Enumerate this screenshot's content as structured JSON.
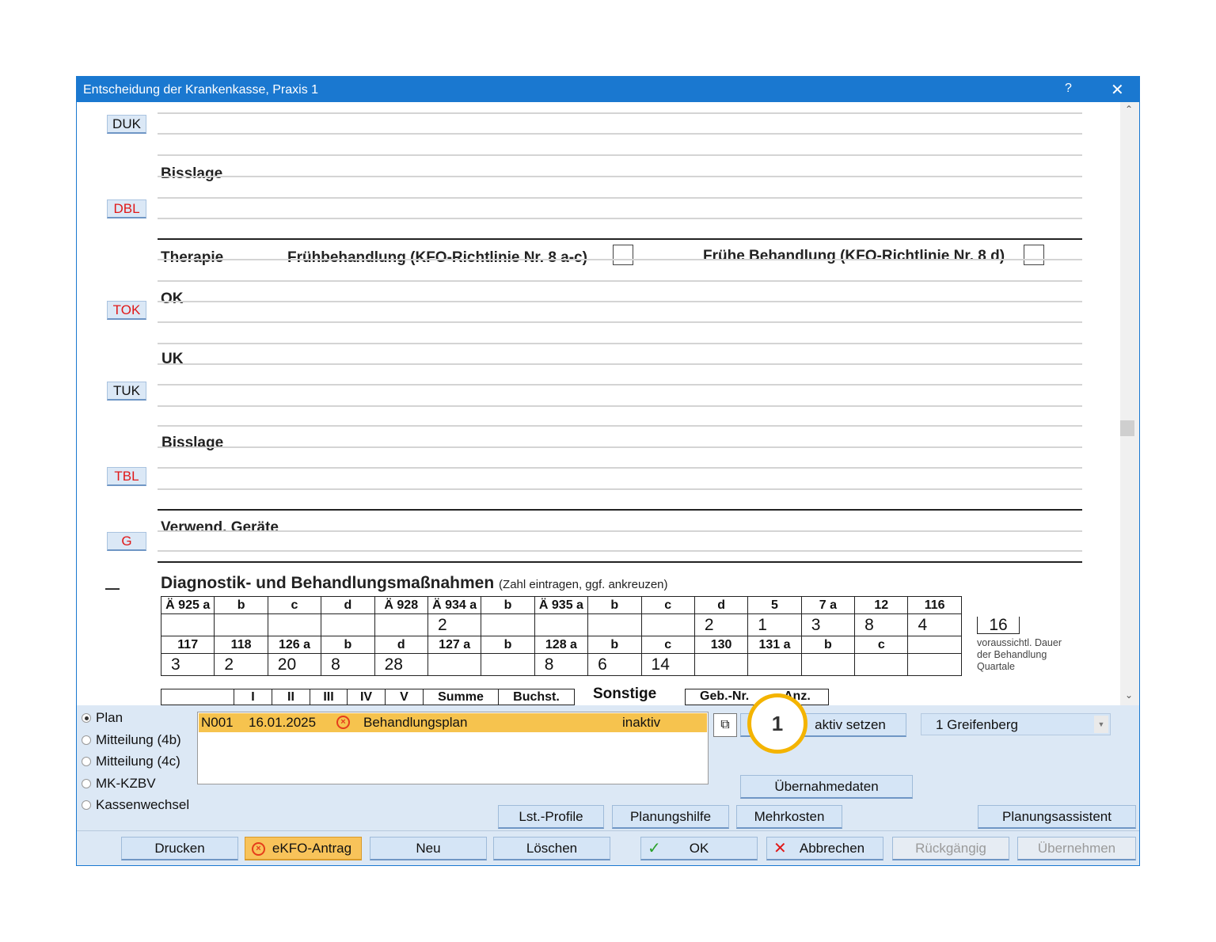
{
  "window": {
    "title": "Entscheidung der Krankenkasse, Praxis 1",
    "help": "?",
    "close": "✕"
  },
  "scroll": {
    "up": "⌃",
    "down": "⌄"
  },
  "tags": {
    "duk": "DUK",
    "dbl": "DBL",
    "tok": "TOK",
    "tuk": "TUK",
    "tbl": "TBL",
    "g": "G",
    "dash": "—"
  },
  "labels": {
    "bisslage1": "Bisslage",
    "therapie": "Therapie",
    "fruehbehandlung": "Frühbehandlung (KFO-Richtlinie Nr. 8 a-c)",
    "fruehe_behandlung": "Frühe Behandlung (KFO-Richtlinie Nr. 8 d)",
    "ok": "OK",
    "uk": "UK",
    "bisslage2": "Bisslage",
    "geraete": "Verwend. Geräte",
    "diag_title": "Diagnostik- und Behandlungsmaßnahmen",
    "diag_hint": "(Zahl eintragen, ggf. ankreuzen)"
  },
  "grid": {
    "row1_headers": [
      "Ä 925 a",
      "b",
      "c",
      "d",
      "Ä 928",
      "Ä 934 a",
      "b",
      "Ä 935 a",
      "b",
      "c",
      "d",
      "5",
      "7 a",
      "12",
      "116"
    ],
    "row1_values": [
      "",
      "",
      "",
      "",
      "",
      "2",
      "",
      "",
      "",
      "",
      "2",
      "1",
      "3",
      "8",
      "4"
    ],
    "row2_headers": [
      "117",
      "118",
      "126 a",
      "b",
      "d",
      "127 a",
      "b",
      "128 a",
      "b",
      "c",
      "130",
      "131 a",
      "b",
      "c",
      ""
    ],
    "row2_values": [
      "3",
      "2",
      "20",
      "8",
      "28",
      "",
      "",
      "8",
      "6",
      "14",
      "",
      "",
      "",
      "",
      ""
    ]
  },
  "duration": {
    "value": "16",
    "line1": "voraussichtl. Dauer",
    "line2": "der Behandlung",
    "line3": "Quartale"
  },
  "summary_row": {
    "cols": [
      "",
      "I",
      "II",
      "III",
      "IV",
      "V",
      "Summe",
      "Buchst."
    ],
    "sonstige": "Sonstige",
    "gebnr": "Geb.-Nr.",
    "anz": "Anz."
  },
  "radios": [
    {
      "label": "Plan",
      "selected": true
    },
    {
      "label": "Mitteilung (4b)",
      "selected": false
    },
    {
      "label": "Mitteilung (4c)",
      "selected": false
    },
    {
      "label": "MK-KZBV",
      "selected": false
    },
    {
      "label": "Kassenwechsel",
      "selected": false
    }
  ],
  "list": [
    {
      "id": "N001",
      "date": "16.01.2025",
      "icon": "error-circle-icon",
      "name": "Behandlungsplan",
      "status": "inaktiv"
    }
  ],
  "buttons": {
    "aktiv_setzen": "aktiv setzen",
    "uebernahmedaten": "Übernahmedaten",
    "lst_profile": "Lst.-Profile",
    "planungshilfe": "Planungshilfe",
    "mehrkosten": "Mehrkosten",
    "planungsassistent": "Planungsassistent",
    "drucken": "Drucken",
    "ekfo": "eKFO-Antrag",
    "neu": "Neu",
    "loeschen": "Löschen",
    "ok": "OK",
    "abbrechen": "Abbrechen",
    "rueckgaengig": "Rückgängig",
    "uebernehmen": "Übernehmen"
  },
  "dropdown": {
    "value": "1 Greifenberg"
  },
  "callout": {
    "number": "1"
  },
  "colors": {
    "titlebar": "#1a78d0",
    "selected_row": "#f6c34e",
    "callout_ring": "#f4b400",
    "red_tag": "#e01818"
  }
}
